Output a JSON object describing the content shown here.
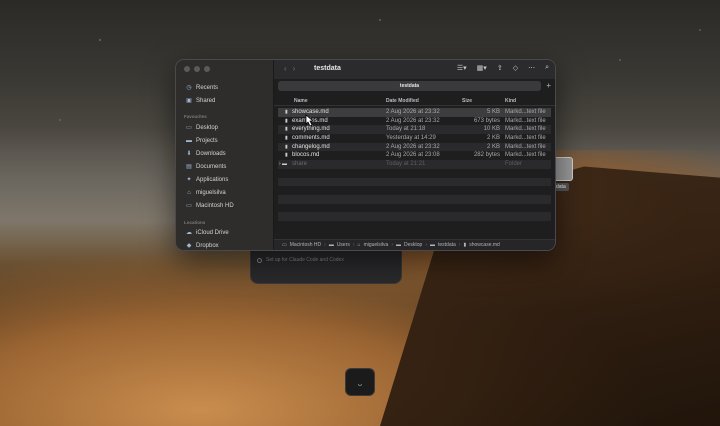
{
  "finder": {
    "window_title": "testdata",
    "tab_label": "testdata",
    "sidebar": {
      "items_top": [
        {
          "label": "Recents",
          "icon": "clock-icon"
        },
        {
          "label": "Shared",
          "icon": "shared-folder-icon"
        }
      ],
      "favourites_header": "Favourites",
      "favourites": [
        {
          "label": "Desktop",
          "icon": "desktop-icon"
        },
        {
          "label": "Projects",
          "icon": "folder-icon"
        },
        {
          "label": "Downloads",
          "icon": "download-icon"
        },
        {
          "label": "Documents",
          "icon": "document-icon"
        },
        {
          "label": "Applications",
          "icon": "applications-icon"
        },
        {
          "label": "miguelsilva",
          "icon": "home-icon"
        },
        {
          "label": "Macintosh HD",
          "icon": "disk-icon"
        }
      ],
      "locations_header": "Locations",
      "locations": [
        {
          "label": "iCloud Drive",
          "icon": "cloud-icon"
        },
        {
          "label": "Dropbox",
          "icon": "dropbox-icon"
        }
      ]
    },
    "columns": {
      "name": "Name",
      "date": "Date Modified",
      "size": "Size",
      "kind": "Kind"
    },
    "files": [
      {
        "name": "showcase.md",
        "date": "2 Aug 2026 at 23:32",
        "size": "5 KB",
        "kind": "Markd...text file"
      },
      {
        "name": "examples.md",
        "date": "2 Aug 2026 at 23:32",
        "size": "673 bytes",
        "kind": "Markd...text file"
      },
      {
        "name": "everything.md",
        "date": "Today at 21:18",
        "size": "10 KB",
        "kind": "Markd...text file"
      },
      {
        "name": "comments.md",
        "date": "Yesterday at 14:29",
        "size": "2 KB",
        "kind": "Markd...text file"
      },
      {
        "name": "changelog.md",
        "date": "2 Aug 2026 at 23:32",
        "size": "2 KB",
        "kind": "Markd...text file"
      },
      {
        "name": "blocos.md",
        "date": "2 Aug 2026 at 23:08",
        "size": "282 bytes",
        "kind": "Markd...text file"
      },
      {
        "name": "share",
        "date": "Today at 21:21",
        "size": "",
        "kind": "Folder"
      }
    ],
    "path": [
      "Macintosh HD",
      "Users",
      "miguelsilva",
      "Desktop",
      "testdata",
      "showcase.md"
    ]
  },
  "background_window": {
    "hint": "Set up for Claude Code and Codex"
  },
  "side_label": "data"
}
